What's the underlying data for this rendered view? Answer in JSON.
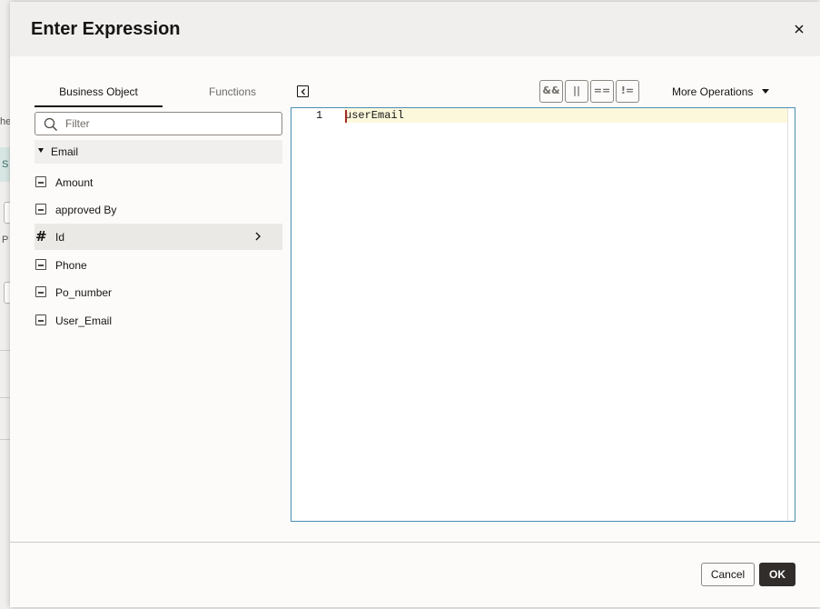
{
  "background": {
    "fragment_1": "he",
    "fragment_2": "S",
    "fragment_3": "P"
  },
  "dialog": {
    "title": "Enter Expression",
    "close_icon": "close-icon"
  },
  "tabs": [
    {
      "label": "Business Object",
      "active": true
    },
    {
      "label": "Functions",
      "active": false
    }
  ],
  "filter": {
    "placeholder": "Filter",
    "value": "",
    "icon": "search-icon"
  },
  "tree": {
    "root": {
      "label": "Email",
      "expanded": true
    },
    "items": [
      {
        "label": "Amount",
        "type": "string",
        "icon": "text-field-icon"
      },
      {
        "label": "approved By",
        "type": "string",
        "icon": "text-field-icon"
      },
      {
        "label": "Id",
        "type": "number",
        "icon": "hash-icon",
        "selected": true,
        "has_children": true
      },
      {
        "label": "Phone",
        "type": "string",
        "icon": "text-field-icon"
      },
      {
        "label": "Po_number",
        "type": "string",
        "icon": "text-field-icon"
      },
      {
        "label": "User_Email",
        "type": "string",
        "icon": "text-field-icon"
      }
    ]
  },
  "toolbar": {
    "operator_buttons": [
      {
        "name": "and-operator",
        "glyph": "&&"
      },
      {
        "name": "or-operator",
        "glyph": "||"
      },
      {
        "name": "equals-operator",
        "glyph": "=="
      },
      {
        "name": "not-operator",
        "glyph": "!="
      }
    ],
    "more_operations_label": "More Operations"
  },
  "editor": {
    "lines": [
      {
        "number": "1",
        "text": "userEmail"
      }
    ]
  },
  "footer": {
    "cancel_label": "Cancel",
    "ok_label": "OK"
  },
  "colors": {
    "ok_button": "#312d2a",
    "editor_border": "#4a8fb0",
    "active_line": "#fcf8dc",
    "selected_row": "#ebe9e6"
  }
}
